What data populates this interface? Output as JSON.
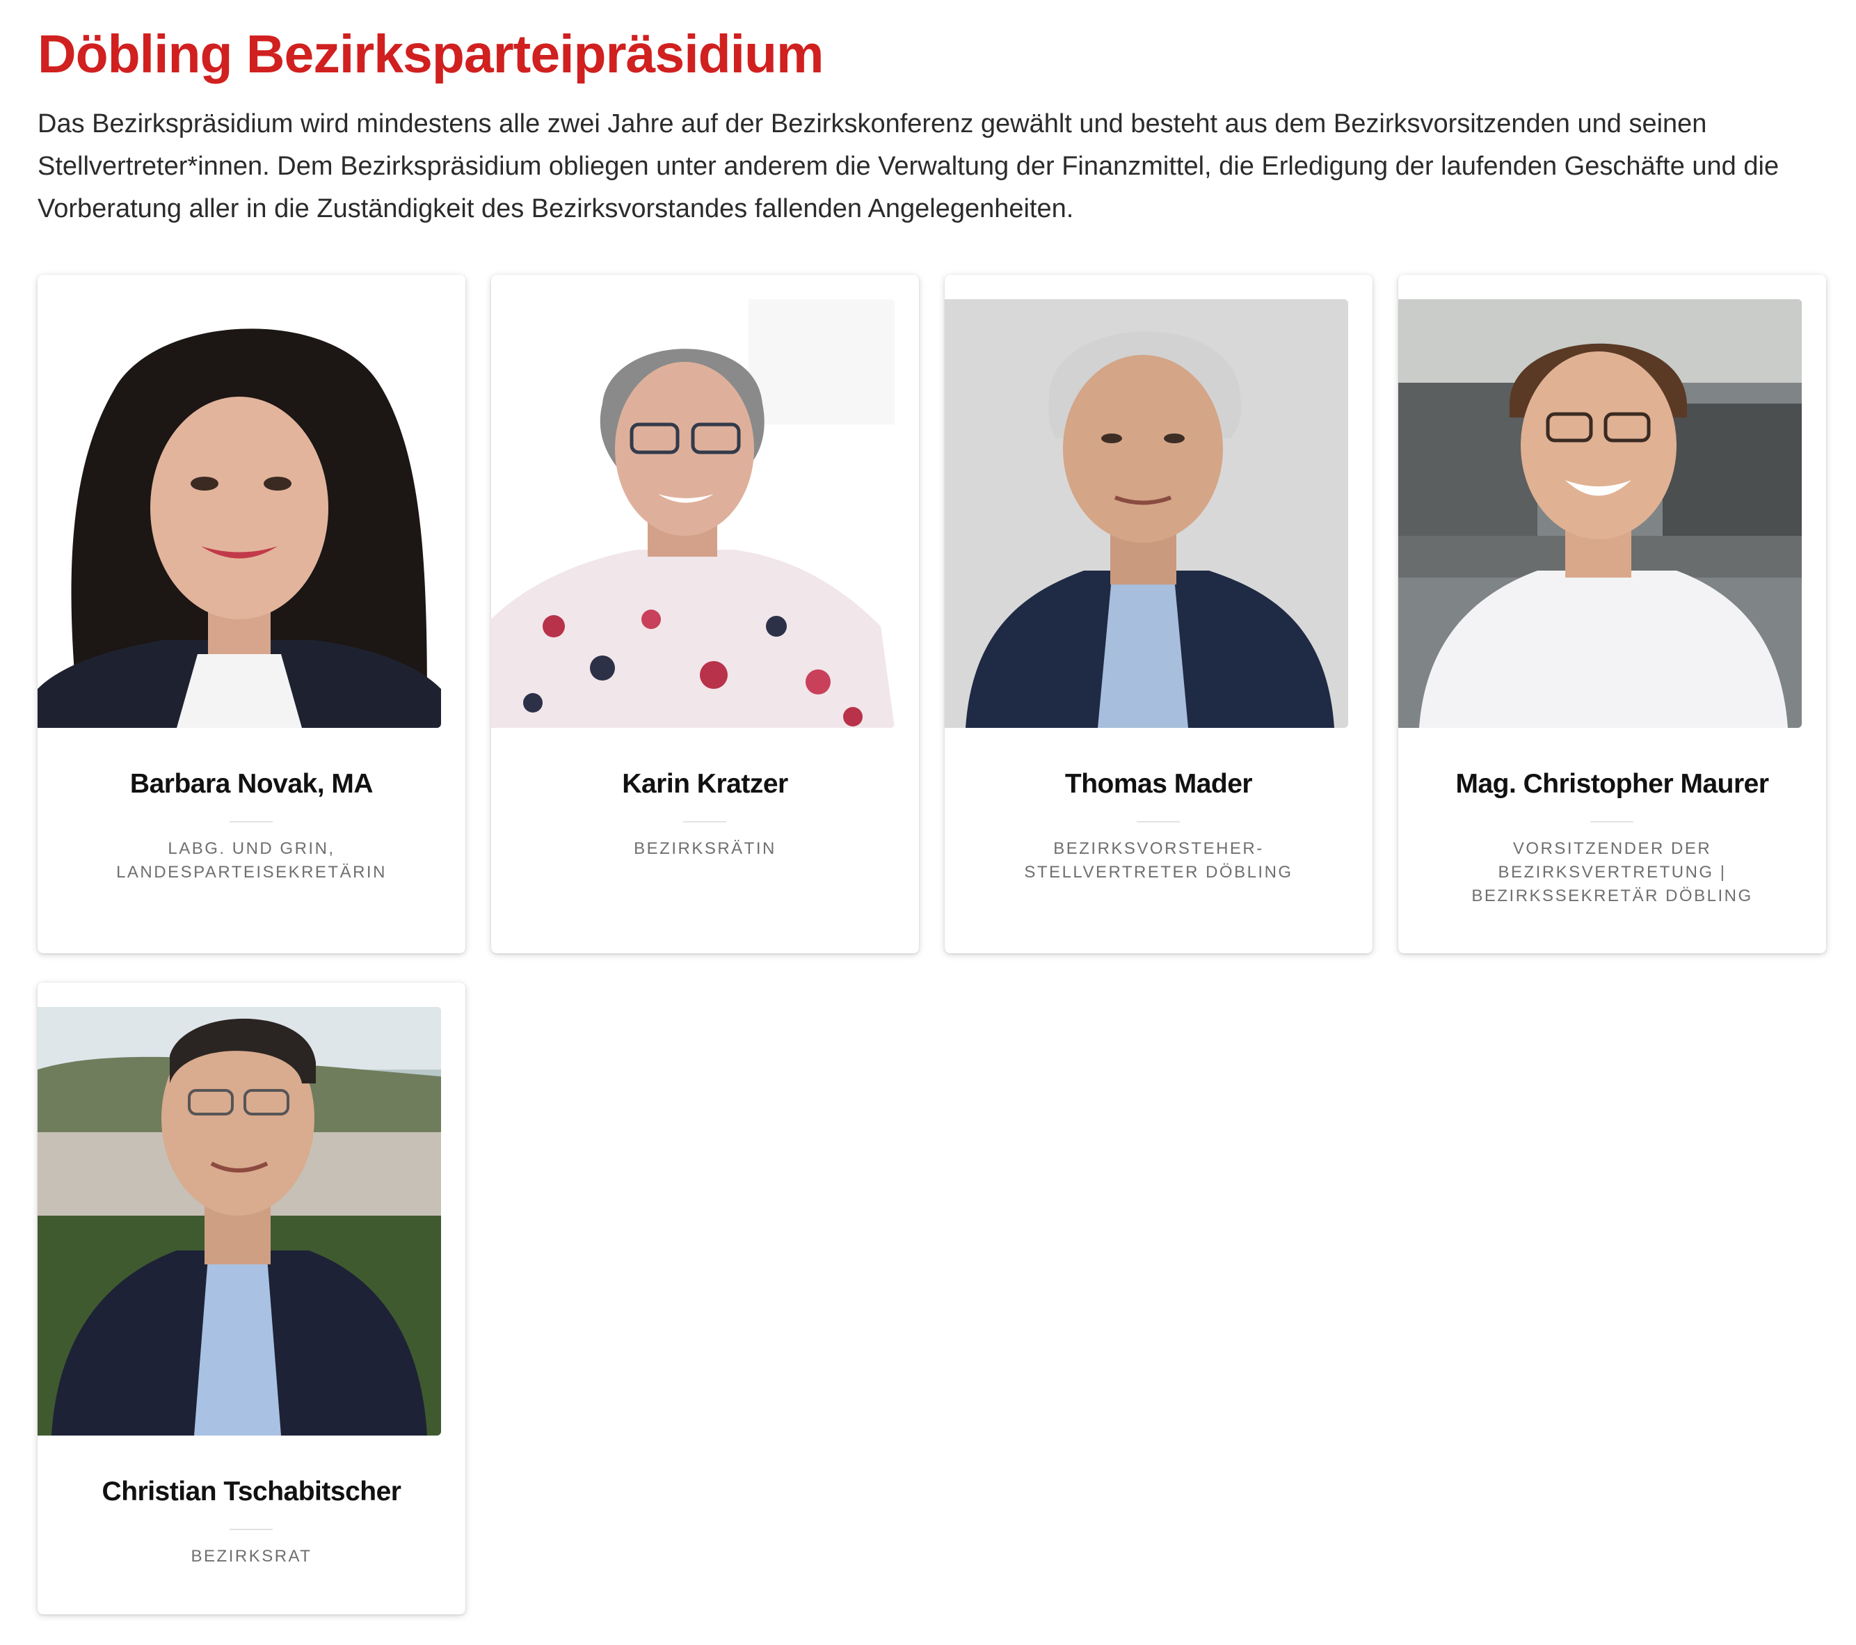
{
  "header": {
    "title": "Döbling Bezirksparteipräsidium",
    "intro": "Das Bezirkspräsidium wird mindestens alle zwei Jahre auf der Bezirkskonferenz gewählt und besteht aus dem Bezirksvorsitzenden und seinen Stellvertreter*innen. Dem Bezirkspräsidium obliegen unter anderem die Verwaltung der Finanzmittel, die Erledigung der laufenden Geschäfte und die Vorberatung aller in die Zuständigkeit des Bezirksvorstandes fallenden Angelegenheiten."
  },
  "colors": {
    "title": "#d0201f",
    "text": "#2b2b2b",
    "role": "#6f6f6f"
  },
  "members": [
    {
      "name": "Barbara Novak, MA",
      "role": "LAbg. und GRin, Landesparteisekretärin"
    },
    {
      "name": "Karin Kratzer",
      "role": "Bezirksrätin"
    },
    {
      "name": "Thomas Mader",
      "role": "Bezirksvorsteher-Stellvertreter Döbling"
    },
    {
      "name": "Mag. Christopher Maurer",
      "role": "Vorsitzender der Bezirksvertretung | Bezirkssekretär Döbling"
    },
    {
      "name": "Christian Tschabitscher",
      "role": "Bezirksrat"
    }
  ]
}
